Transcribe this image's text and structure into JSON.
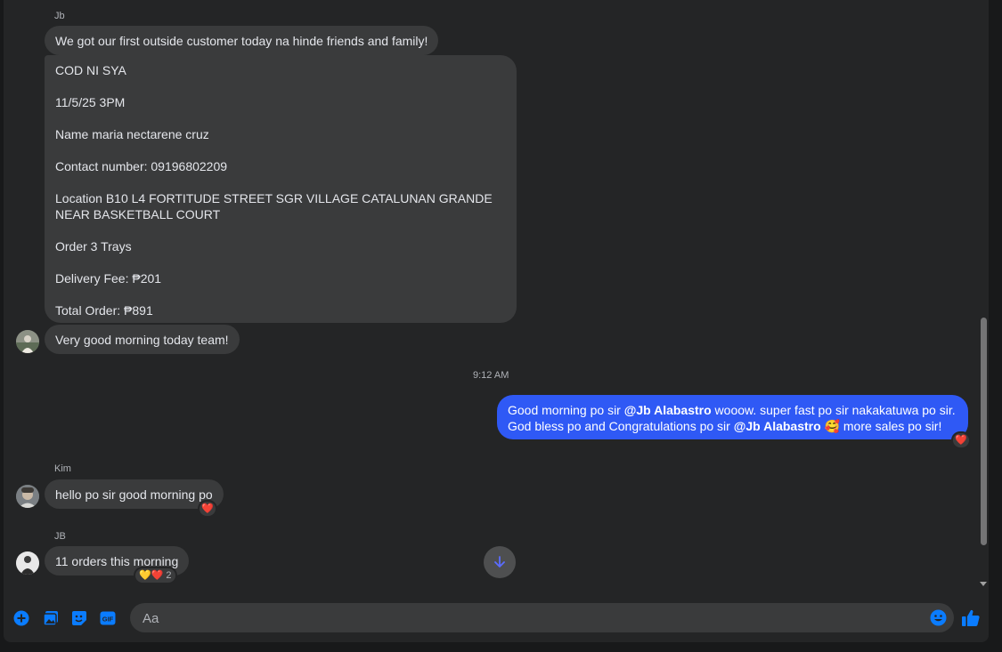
{
  "colors": {
    "accent": "#2f59f5",
    "icon_blue": "#0a7cff",
    "bubble_bg": "#3a3b3c",
    "panel_bg": "#242526",
    "heart": "#e41e3f"
  },
  "messages": {
    "jb_name": "Jb",
    "jb_msg1": "We got our first outside customer today na hinde friends and family!",
    "order": {
      "line1": "COD NI SYA",
      "line2": "11/5/25 3PM",
      "line3": "Name maria nectarene cruz",
      "line4": "Contact number: 09196802209",
      "line5": "Location B10 L4 FORTITUDE STREET SGR VILLAGE CATALUNAN GRANDE NEAR BASKETBALL COURT",
      "line6": "Order 3 Trays",
      "line7": "Delivery Fee: ₱201",
      "line8": "Total Order: ₱891"
    },
    "jb_msg3": "Very good morning today team!",
    "timestamp": "9:12 AM",
    "me": {
      "part1": "Good morning po sir ",
      "mention1": "@Jb Alabastro",
      "part2": " wooow. super fast po sir nakakatuwa po sir. God bless po and Congratulations po sir ",
      "mention2": "@Jb Alabastro",
      "emoji": "🥰",
      "part3": " more sales po sir!",
      "reaction": "❤️"
    },
    "kim_name": "Kim",
    "kim_msg": "hello po sir good morning po",
    "kim_reaction": "❤️",
    "jb2_name": "JB",
    "jb2_msg": "11 orders this morning",
    "jb2_reaction_emojis": "💛❤️",
    "jb2_reaction_count": "2"
  },
  "composer": {
    "placeholder": "Aa",
    "icons": [
      "plus-icon",
      "image-icon",
      "sticker-icon",
      "gif-icon",
      "emoji-icon",
      "like-icon"
    ],
    "gif_label": "GIF"
  }
}
